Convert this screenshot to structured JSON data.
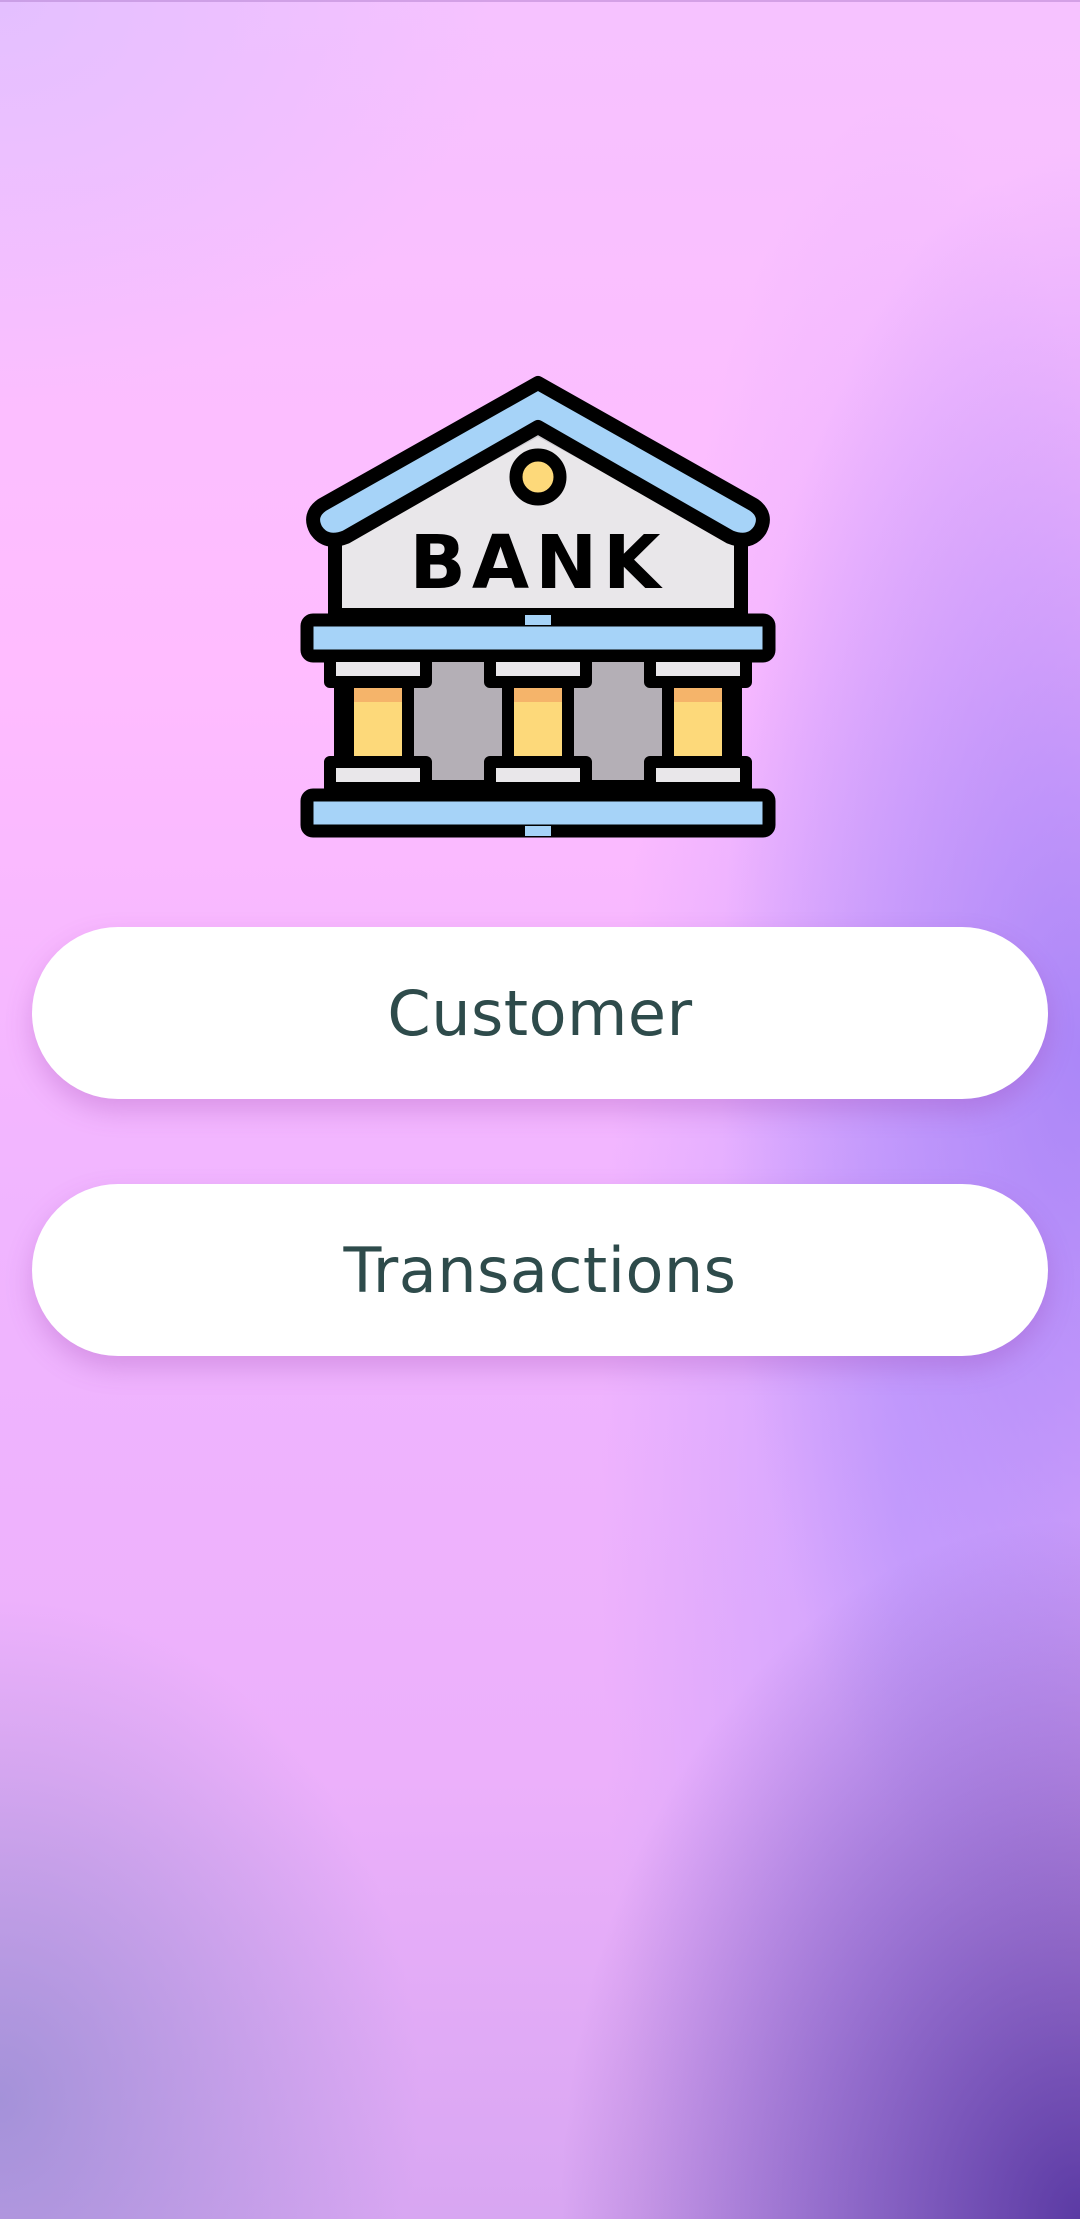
{
  "logo": {
    "icon": "bank-building-icon",
    "text": "BANK"
  },
  "buttons": {
    "customer_label": "Customer",
    "transactions_label": "Transactions"
  },
  "colors": {
    "button_text": "#2e4b4b",
    "button_bg": "#ffffff",
    "roof_blue": "#a6d3f8",
    "pillar_yellow": "#fdd97a",
    "facade_gray": "#e9e7ea"
  }
}
